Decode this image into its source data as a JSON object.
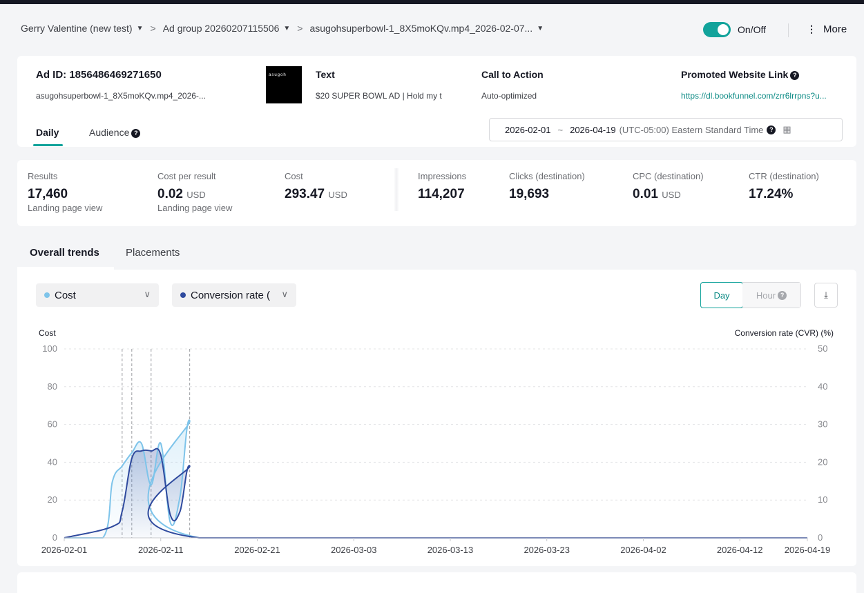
{
  "breadcrumb": {
    "account": "Gerry Valentine (new test)",
    "ad_group": "Ad group 20260207115506",
    "ad": "asugohsuperbowl-1_8X5moKQv.mp4_2026-02-07..."
  },
  "header": {
    "toggle_label": "On/Off",
    "toggle_on": true,
    "more_label": "More"
  },
  "ad": {
    "id_label": "Ad ID: 1856486469271650",
    "name": "asugohsuperbowl-1_8X5moKQv.mp4_2026-...",
    "thumb_text": "asugoh",
    "text_header": "Text",
    "text_value": "$20 SUPER BOWL AD | Hold my t",
    "cta_header": "Call to Action",
    "cta_value": "Auto-optimized",
    "link_header": "Promoted Website Link",
    "link_value": "https://dl.bookfunnel.com/zrr6lrrpns?u..."
  },
  "tabs": {
    "daily": "Daily",
    "audience": "Audience"
  },
  "date_range": {
    "start": "2026-02-01",
    "end": "2026-04-19",
    "timezone": "(UTC-05:00) Eastern Standard Time"
  },
  "metrics": [
    {
      "label": "Results",
      "value": "17,460",
      "unit": "",
      "sub": "Landing page view"
    },
    {
      "label": "Cost per result",
      "value": "0.02",
      "unit": "USD",
      "sub": "Landing page view"
    },
    {
      "label": "Cost",
      "value": "293.47",
      "unit": "USD",
      "sub": ""
    },
    {
      "label": "Impressions",
      "value": "114,207",
      "unit": "",
      "sub": ""
    },
    {
      "label": "Clicks (destination)",
      "value": "19,693",
      "unit": "",
      "sub": ""
    },
    {
      "label": "CPC (destination)",
      "value": "0.01",
      "unit": "USD",
      "sub": ""
    },
    {
      "label": "CTR (destination)",
      "value": "17.24%",
      "unit": "",
      "sub": ""
    }
  ],
  "trend_tabs": {
    "overall": "Overall trends",
    "placements": "Placements"
  },
  "selectors": {
    "left": "Cost",
    "right": "Conversion rate ("
  },
  "granularity": {
    "day": "Day",
    "hour": "Hour"
  },
  "colors": {
    "accent": "#12a39b",
    "cost_series": "#7ec4ea",
    "cvr_series": "#2f4a9e"
  },
  "chart_data": {
    "type": "line",
    "left_axis_label": "Cost",
    "right_axis_label": "Conversion rate (CVR) (%)",
    "y_left": [
      0,
      20,
      40,
      60,
      80,
      100
    ],
    "y_right": [
      0,
      10,
      20,
      30,
      40,
      50
    ],
    "ylim_left": [
      0,
      100
    ],
    "ylim_right": [
      0,
      50
    ],
    "x_ticks": [
      "2026-02-01",
      "2026-02-11",
      "2026-02-21",
      "2026-03-03",
      "2026-03-13",
      "2026-03-23",
      "2026-04-02",
      "2026-04-12",
      "2026-04-19"
    ],
    "marker_days": [
      6,
      7,
      9,
      13
    ],
    "total_days": 77,
    "series": [
      {
        "name": "Cost",
        "color": "#7ec4ea",
        "points": [
          [
            0,
            0
          ],
          [
            4,
            0
          ],
          [
            5,
            30
          ],
          [
            6,
            38
          ],
          [
            7,
            45
          ],
          [
            8,
            50
          ],
          [
            9,
            28
          ],
          [
            10,
            50
          ],
          [
            11,
            8
          ],
          [
            12,
            22
          ],
          [
            13,
            62
          ],
          [
            14,
            0
          ],
          [
            77,
            0
          ]
        ]
      },
      {
        "name": "Conversion rate (CVR)",
        "color": "#2f4a9e",
        "points": [
          [
            0,
            0
          ],
          [
            5,
            3
          ],
          [
            6,
            7
          ],
          [
            7,
            21
          ],
          [
            8,
            23
          ],
          [
            9,
            23
          ],
          [
            10,
            22
          ],
          [
            11,
            6
          ],
          [
            12,
            7
          ],
          [
            13,
            19
          ],
          [
            14,
            0
          ],
          [
            77,
            0
          ]
        ]
      }
    ]
  }
}
